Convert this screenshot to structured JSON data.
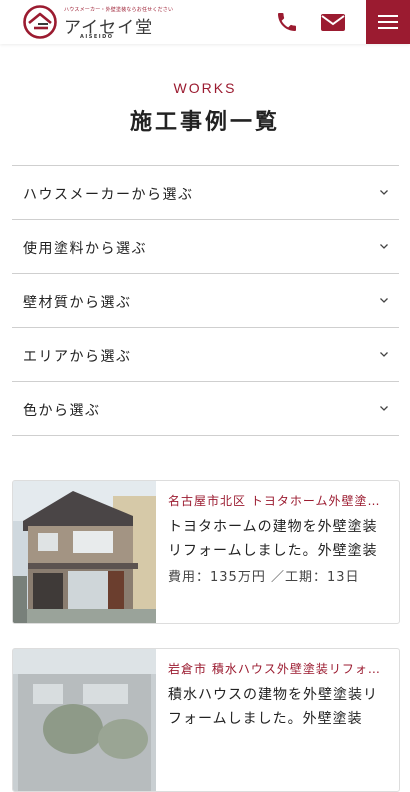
{
  "header": {
    "logo_tagline": "ハウスメーカー・外壁塗装ならお任せください",
    "logo_name": "アイセイ堂",
    "logo_sub": "AISEIDO",
    "phone_icon": "phone-icon",
    "mail_icon": "mail-icon",
    "menu_icon": "hamburger-icon",
    "brand_color": "#9b1b30"
  },
  "page": {
    "label": "WORKS",
    "title": "施工事例一覧"
  },
  "filters": [
    {
      "label": "ハウスメーカーから選ぶ"
    },
    {
      "label": "使用塗料から選ぶ"
    },
    {
      "label": "壁材質から選ぶ"
    },
    {
      "label": "エリアから選ぶ"
    },
    {
      "label": "色から選ぶ"
    }
  ],
  "cards": [
    {
      "category": "名古屋市北区 トヨタホーム外壁塗装リフォーム",
      "description": "トヨタホームの建物を外壁塗装リフォームしました。外壁塗装",
      "meta": "費用：135万円 ／工期：13日"
    },
    {
      "category": "岩倉市 積水ハウス外壁塗装リフォーム",
      "description": "積水ハウスの建物を外壁塗装リフォームしました。外壁塗装",
      "meta": ""
    }
  ]
}
